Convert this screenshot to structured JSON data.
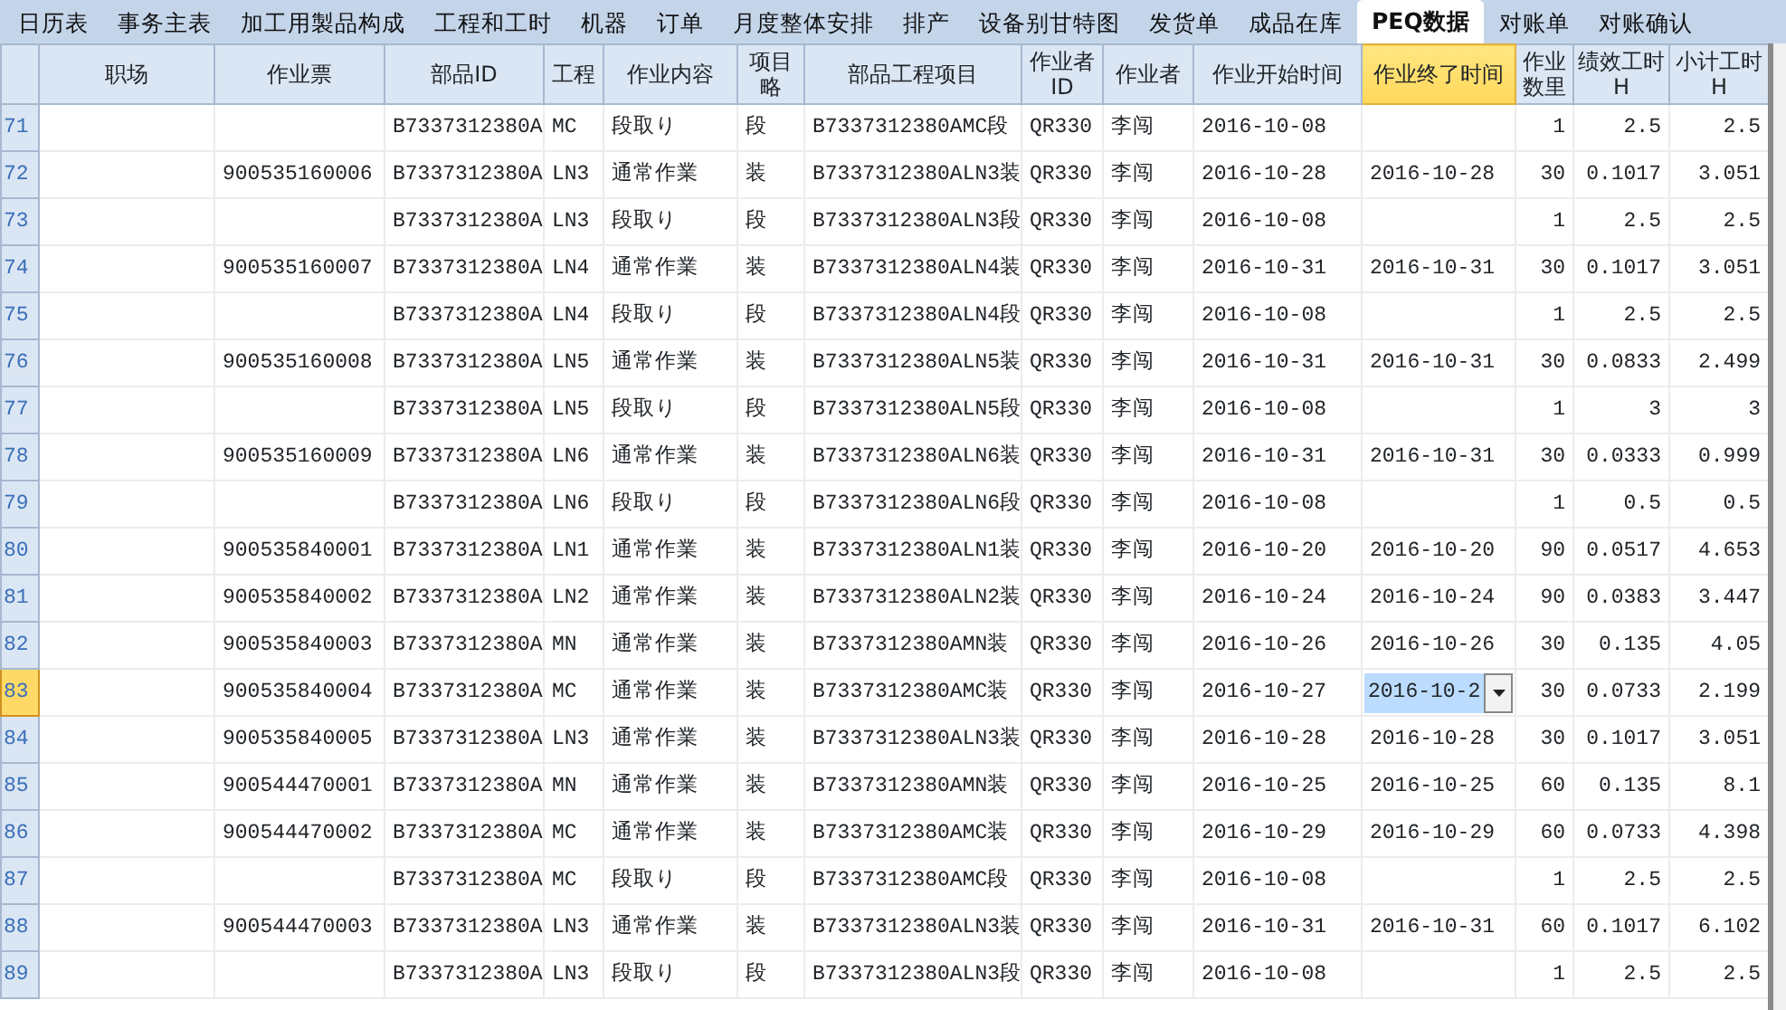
{
  "tabs": [
    {
      "label": "日历表",
      "selected": false
    },
    {
      "label": "事务主表",
      "selected": false
    },
    {
      "label": "加工用製品构成",
      "selected": false
    },
    {
      "label": "工程和工时",
      "selected": false
    },
    {
      "label": "机器",
      "selected": false
    },
    {
      "label": "订单",
      "selected": false
    },
    {
      "label": "月度整体安排",
      "selected": false
    },
    {
      "label": "排产",
      "selected": false
    },
    {
      "label": "设备别甘特图",
      "selected": false
    },
    {
      "label": "发货单",
      "selected": false
    },
    {
      "label": "成品在库",
      "selected": false
    },
    {
      "label": "PEQ数据",
      "selected": true
    },
    {
      "label": "对账单",
      "selected": false
    },
    {
      "label": "对账确认",
      "selected": false
    }
  ],
  "table": {
    "columns": [
      {
        "label": "职场",
        "kind": "text",
        "selected": false
      },
      {
        "label": "作业票",
        "kind": "text",
        "selected": false
      },
      {
        "label": "部品ID",
        "kind": "text",
        "selected": false
      },
      {
        "label": "工程",
        "kind": "text",
        "selected": false
      },
      {
        "label": "作业内容",
        "kind": "text",
        "selected": false
      },
      {
        "label": "项目略",
        "kind": "text",
        "selected": false
      },
      {
        "label": "部品工程项目",
        "kind": "text",
        "selected": false
      },
      {
        "label": "作业者ID",
        "kind": "text",
        "selected": false
      },
      {
        "label": "作业者",
        "kind": "text",
        "selected": false
      },
      {
        "label": "作业开始时间",
        "kind": "text",
        "selected": false
      },
      {
        "label": "作业终了时间",
        "kind": "text",
        "selected": true
      },
      {
        "label": "作业数里",
        "kind": "number",
        "selected": false
      },
      {
        "label": "绩效工时H",
        "kind": "number",
        "selected": false
      },
      {
        "label": "小计工时H",
        "kind": "number",
        "selected": false
      }
    ],
    "rows": [
      {
        "number": "71",
        "selected": false,
        "cells": [
          "",
          "",
          "B7337312380A",
          "MC",
          "段取り",
          "段",
          "B7337312380AMC段",
          "QR330",
          "李闯",
          "2016-10-08",
          "",
          "1",
          "2.5",
          "2.5"
        ]
      },
      {
        "number": "72",
        "selected": false,
        "cells": [
          "",
          "900535160006",
          "B7337312380A",
          "LN3",
          "通常作業",
          "装",
          "B7337312380ALN3装",
          "QR330",
          "李闯",
          "2016-10-28",
          "2016-10-28",
          "30",
          "0.1017",
          "3.051"
        ]
      },
      {
        "number": "73",
        "selected": false,
        "cells": [
          "",
          "",
          "B7337312380A",
          "LN3",
          "段取り",
          "段",
          "B7337312380ALN3段",
          "QR330",
          "李闯",
          "2016-10-08",
          "",
          "1",
          "2.5",
          "2.5"
        ]
      },
      {
        "number": "74",
        "selected": false,
        "cells": [
          "",
          "900535160007",
          "B7337312380A",
          "LN4",
          "通常作業",
          "装",
          "B7337312380ALN4装",
          "QR330",
          "李闯",
          "2016-10-31",
          "2016-10-31",
          "30",
          "0.1017",
          "3.051"
        ]
      },
      {
        "number": "75",
        "selected": false,
        "cells": [
          "",
          "",
          "B7337312380A",
          "LN4",
          "段取り",
          "段",
          "B7337312380ALN4段",
          "QR330",
          "李闯",
          "2016-10-08",
          "",
          "1",
          "2.5",
          "2.5"
        ]
      },
      {
        "number": "76",
        "selected": false,
        "cells": [
          "",
          "900535160008",
          "B7337312380A",
          "LN5",
          "通常作業",
          "装",
          "B7337312380ALN5装",
          "QR330",
          "李闯",
          "2016-10-31",
          "2016-10-31",
          "30",
          "0.0833",
          "2.499"
        ]
      },
      {
        "number": "77",
        "selected": false,
        "cells": [
          "",
          "",
          "B7337312380A",
          "LN5",
          "段取り",
          "段",
          "B7337312380ALN5段",
          "QR330",
          "李闯",
          "2016-10-08",
          "",
          "1",
          "3",
          "3"
        ]
      },
      {
        "number": "78",
        "selected": false,
        "cells": [
          "",
          "900535160009",
          "B7337312380A",
          "LN6",
          "通常作業",
          "装",
          "B7337312380ALN6装",
          "QR330",
          "李闯",
          "2016-10-31",
          "2016-10-31",
          "30",
          "0.0333",
          "0.999"
        ]
      },
      {
        "number": "79",
        "selected": false,
        "cells": [
          "",
          "",
          "B7337312380A",
          "LN6",
          "段取り",
          "段",
          "B7337312380ALN6段",
          "QR330",
          "李闯",
          "2016-10-08",
          "",
          "1",
          "0.5",
          "0.5"
        ]
      },
      {
        "number": "80",
        "selected": false,
        "cells": [
          "",
          "900535840001",
          "B7337312380A",
          "LN1",
          "通常作業",
          "装",
          "B7337312380ALN1装",
          "QR330",
          "李闯",
          "2016-10-20",
          "2016-10-20",
          "90",
          "0.0517",
          "4.653"
        ]
      },
      {
        "number": "81",
        "selected": false,
        "cells": [
          "",
          "900535840002",
          "B7337312380A",
          "LN2",
          "通常作業",
          "装",
          "B7337312380ALN2装",
          "QR330",
          "李闯",
          "2016-10-24",
          "2016-10-24",
          "90",
          "0.0383",
          "3.447"
        ]
      },
      {
        "number": "82",
        "selected": false,
        "cells": [
          "",
          "900535840003",
          "B7337312380A",
          "MN",
          "通常作業",
          "装",
          "B7337312380AMN装",
          "QR330",
          "李闯",
          "2016-10-26",
          "2016-10-26",
          "30",
          "0.135",
          "4.05"
        ]
      },
      {
        "number": "83",
        "selected": true,
        "cells": [
          "",
          "900535840004",
          "B7337312380A",
          "MC",
          "通常作業",
          "装",
          "B7337312380AMC装",
          "QR330",
          "李闯",
          "2016-10-27",
          "2016-10-2",
          "30",
          "0.0733",
          "2.199"
        ]
      },
      {
        "number": "84",
        "selected": false,
        "cells": [
          "",
          "900535840005",
          "B7337312380A",
          "LN3",
          "通常作業",
          "装",
          "B7337312380ALN3装",
          "QR330",
          "李闯",
          "2016-10-28",
          "2016-10-28",
          "30",
          "0.1017",
          "3.051"
        ]
      },
      {
        "number": "85",
        "selected": false,
        "cells": [
          "",
          "900544470001",
          "B7337312380A",
          "MN",
          "通常作業",
          "装",
          "B7337312380AMN装",
          "QR330",
          "李闯",
          "2016-10-25",
          "2016-10-25",
          "60",
          "0.135",
          "8.1"
        ]
      },
      {
        "number": "86",
        "selected": false,
        "cells": [
          "",
          "900544470002",
          "B7337312380A",
          "MC",
          "通常作業",
          "装",
          "B7337312380AMC装",
          "QR330",
          "李闯",
          "2016-10-29",
          "2016-10-29",
          "60",
          "0.0733",
          "4.398"
        ]
      },
      {
        "number": "87",
        "selected": false,
        "cells": [
          "",
          "",
          "B7337312380A",
          "MC",
          "段取り",
          "段",
          "B7337312380AMC段",
          "QR330",
          "李闯",
          "2016-10-08",
          "",
          "1",
          "2.5",
          "2.5"
        ]
      },
      {
        "number": "88",
        "selected": false,
        "cells": [
          "",
          "900544470003",
          "B7337312380A",
          "LN3",
          "通常作業",
          "装",
          "B7337312380ALN3装",
          "QR330",
          "李闯",
          "2016-10-31",
          "2016-10-31",
          "60",
          "0.1017",
          "6.102"
        ]
      },
      {
        "number": "89",
        "selected": false,
        "cells": [
          "",
          "",
          "B7337312380A",
          "LN3",
          "段取り",
          "段",
          "B7337312380ALN3段",
          "QR330",
          "李闯",
          "2016-10-08",
          "",
          "1",
          "2.5",
          "2.5"
        ]
      }
    ]
  }
}
